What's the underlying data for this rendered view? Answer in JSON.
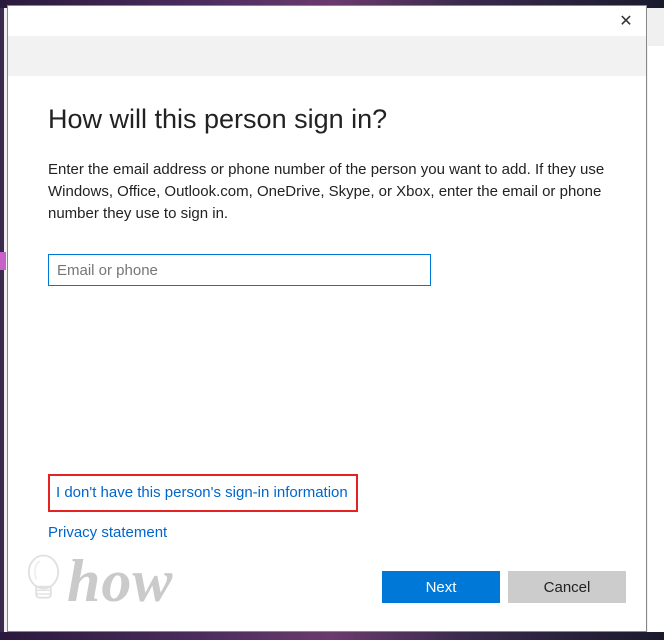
{
  "dialog": {
    "title": "How will this person sign in?",
    "description": "Enter the email address or phone number of the person you want to add. If they use Windows, Office, Outlook.com, OneDrive, Skype, or Xbox, enter the email or phone number they use to sign in.",
    "input_placeholder": "Email or phone",
    "input_value": "",
    "link_no_info": "I don't have this person's sign-in information",
    "link_privacy": "Privacy statement",
    "btn_next": "Next",
    "btn_cancel": "Cancel"
  },
  "watermark": {
    "text": "how"
  }
}
